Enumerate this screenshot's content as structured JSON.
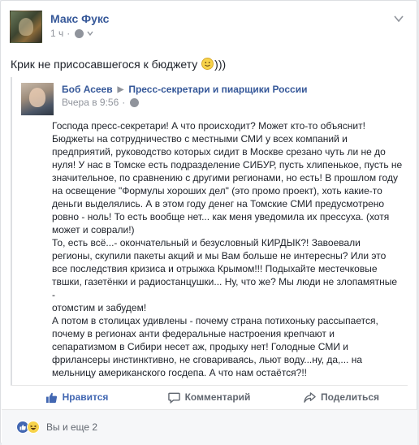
{
  "post": {
    "author": "Макс Фукс",
    "time": "1 ч",
    "text": "Крик не присосавшегося к бюджету",
    "text_suffix": ")))",
    "menu_icon": "chevron-down-icon"
  },
  "shared": {
    "author": "Боб Асеев",
    "arrow": "▶",
    "group": "Пресс-секретари и пиарщики России",
    "time": "Вчера в 9:56",
    "body_lines": [
      "Господа пресс-секретари! А что происходит? Может кто-то объяснит!",
      "Бюджеты на сотрудничество с местными СМИ у всех компаний и",
      "предприятий, руководство которых сидит в Москве срезано чуть ли не до",
      "нуля! У нас в Томске есть подразделение СИБУР, пусть хлипенькое, пусть не",
      "значительное, по сравнению с другими регионами, но есть! В прошлом году",
      "на освещение \"Формулы хороших дел\" (это промо проект), хоть какие-то",
      "деньги выделялись. А в этом году денег на Томские СМИ предусмотрено",
      "ровно - ноль! То есть вообще нет... как меня уведомила их прессуха. (хотя",
      "может и соврали!)",
      "То, есть всё...- окончательный и безусловный КИРДЫК?! Завоевали",
      "регионы, скупили пакеты акций и мы Вам больше не интересны? Или это",
      "все последствия кризиса и отрыжка Крымом!!! Подыхайте местечковые",
      "твшки, газетёнки и радиостанцушки... Ну, что же? Мы люди не злопамятные -",
      "отомстим и забудем!",
      "А потом в столицах удивлены - почему страна потихоньку рассыпается,",
      "почему в регионах анти федеральные настроения крепчают и",
      "сепаратизмом в Сибири несет аж, продыху нет! Голодные СМИ и",
      "фрилансеры инстинктивно, не сговариваясь, льют воду...ну, да,... на",
      "мельницу американского госдепа. А что нам остаётся?!!"
    ]
  },
  "actions": {
    "like": "Нравится",
    "comment": "Комментарий",
    "share": "Поделиться"
  },
  "reactions": {
    "text": "Вы и еще 2"
  },
  "colors": {
    "link": "#365899",
    "liked": "#4267b2",
    "muted": "#90949c"
  }
}
